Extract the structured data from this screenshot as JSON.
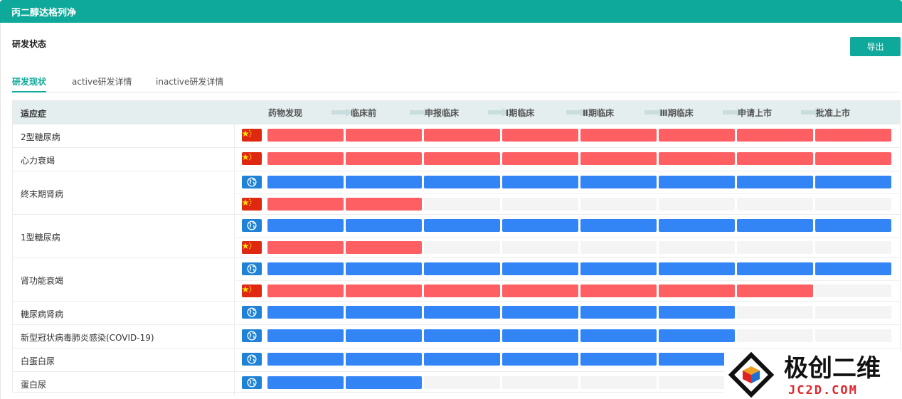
{
  "header": {
    "title": "丙二醇达格列净"
  },
  "section": {
    "title": "研发状态",
    "export_label": "导出"
  },
  "tabs": [
    {
      "label": "研发现状",
      "active": true
    },
    {
      "label": "active研发详情",
      "active": false
    },
    {
      "label": "inactive研发详情",
      "active": false
    }
  ],
  "table": {
    "indication_header": "适应症",
    "stages": [
      "药物发现",
      "临床前",
      "申报临床",
      "Ⅰ期临床",
      "Ⅱ期临床",
      "Ⅲ期临床",
      "申请上市",
      "批准上市"
    ],
    "colors": {
      "china": "#fd5f63",
      "global": "#3385f6",
      "empty": "#f4f4f4"
    },
    "rows": [
      {
        "indication": "2型糖尿病",
        "tracks": [
          {
            "region": "china",
            "reached_stages": 8
          }
        ]
      },
      {
        "indication": "心力衰竭",
        "tracks": [
          {
            "region": "china",
            "reached_stages": 8
          }
        ]
      },
      {
        "indication": "终末期肾病",
        "tracks": [
          {
            "region": "global",
            "reached_stages": 8
          },
          {
            "region": "china",
            "reached_stages": 2
          }
        ]
      },
      {
        "indication": "1型糖尿病",
        "tracks": [
          {
            "region": "global",
            "reached_stages": 8
          },
          {
            "region": "china",
            "reached_stages": 2
          }
        ]
      },
      {
        "indication": "肾功能衰竭",
        "tracks": [
          {
            "region": "global",
            "reached_stages": 8
          },
          {
            "region": "china",
            "reached_stages": 7
          }
        ]
      },
      {
        "indication": "糖尿病肾病",
        "tracks": [
          {
            "region": "global",
            "reached_stages": 6
          }
        ]
      },
      {
        "indication": "新型冠状病毒肺炎感染(COVID-19)",
        "tracks": [
          {
            "region": "global",
            "reached_stages": 6
          }
        ]
      },
      {
        "indication": "白蛋白尿",
        "tracks": [
          {
            "region": "global",
            "reached_stages": 6
          }
        ]
      },
      {
        "indication": "蛋白尿",
        "tracks": [
          {
            "region": "global",
            "reached_stages": 2
          }
        ]
      }
    ]
  },
  "watermark": {
    "brand_cn": "极创二维",
    "brand_en": "JC2D.COM"
  }
}
